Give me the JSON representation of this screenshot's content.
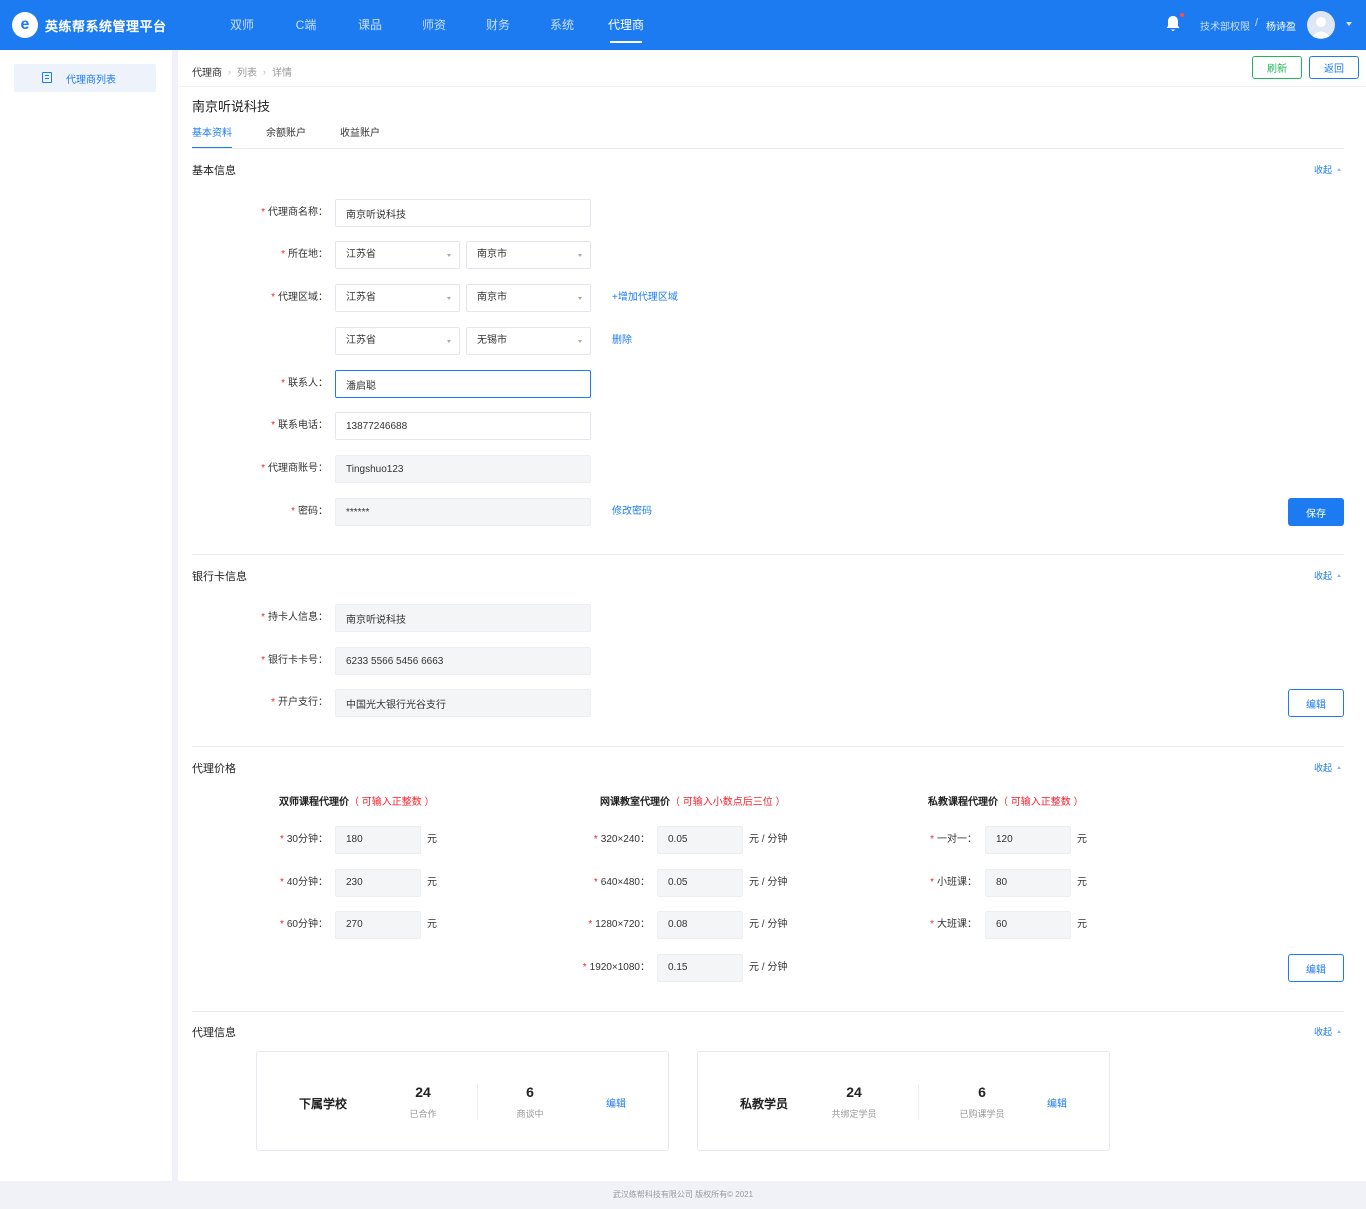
{
  "header": {
    "logo_mark": "e",
    "app_title": "英练帮系统管理平台",
    "nav": [
      "双师",
      "C端",
      "课品",
      "师资",
      "财务",
      "系统",
      "代理商"
    ],
    "active_nav": "代理商",
    "user_role": "技术部权限",
    "user_sep": "/",
    "user_name": "杨诗盈"
  },
  "sidebar": {
    "item_label": "代理商列表"
  },
  "main": {
    "breadcrumb": [
      "代理商",
      "列表",
      "详情"
    ],
    "refresh_label": "刷新",
    "back_label": "返回",
    "company_name": "南京听说科技",
    "tabs": [
      "基本资料",
      "余额账户",
      "收益账户"
    ],
    "collapse_label": "收起"
  },
  "basic": {
    "title": "基本信息",
    "name_label": "代理商名称：",
    "name_value": "南京听说科技",
    "location_label": "所在地：",
    "location_province": "江苏省",
    "location_city": "南京市",
    "region_label": "代理区域：",
    "region1_province": "江苏省",
    "region1_city": "南京市",
    "add_region_label": "+增加代理区域",
    "region2_province": "江苏省",
    "region2_city": "无锡市",
    "delete_label": "删除",
    "contact_label": "联系人：",
    "contact_value": "潘启聪",
    "phone_label": "联系电话：",
    "phone_value": "13877246688",
    "account_label": "代理商账号：",
    "account_value": "Tingshuo123",
    "password_label": "密码：",
    "password_value": "******",
    "change_password_label": "修改密码",
    "save_label": "保存"
  },
  "bank": {
    "title": "银行卡信息",
    "holder_label": "持卡人信息：",
    "holder_value": "南京听说科技",
    "card_label": "银行卡卡号：",
    "card_value": "6233 5566 5456 6663",
    "branch_label": "开户支行：",
    "branch_value": "中国光大银行光谷支行",
    "edit_label": "编辑"
  },
  "price": {
    "title": "代理价格",
    "edit_label": "编辑",
    "dual": {
      "title": "双师课程代理价",
      "hint": "（ 可输入正整数 ）",
      "unit": "元",
      "rows": [
        {
          "label": "30分钟：",
          "value": "180"
        },
        {
          "label": "40分钟：",
          "value": "230"
        },
        {
          "label": "60分钟：",
          "value": "270"
        }
      ]
    },
    "online": {
      "title": "网课教室代理价",
      "hint": "（ 可输入小数点后三位 ）",
      "unit": "元 / 分钟",
      "rows": [
        {
          "label": "320×240：",
          "value": "0.05"
        },
        {
          "label": "640×480：",
          "value": "0.05"
        },
        {
          "label": "1280×720：",
          "value": "0.08"
        },
        {
          "label": "1920×1080：",
          "value": "0.15"
        }
      ]
    },
    "private": {
      "title": "私教课程代理价",
      "hint": "（ 可输入正整数 ）",
      "unit": "元",
      "rows": [
        {
          "label": "一对一：",
          "value": "120"
        },
        {
          "label": "小班课：",
          "value": "80"
        },
        {
          "label": "大班课：",
          "value": "60"
        }
      ]
    }
  },
  "agent_info": {
    "title": "代理信息",
    "edit_label": "编辑",
    "schools": {
      "title": "下属学校",
      "stat1_num": "24",
      "stat1_label": "已合作",
      "stat2_num": "6",
      "stat2_label": "商谈中"
    },
    "students": {
      "title": "私教学员",
      "stat1_num": "24",
      "stat1_label": "共绑定学员",
      "stat2_num": "6",
      "stat2_label": "已购课学员"
    }
  },
  "footer": {
    "text": "武汉练帮科技有限公司 版权所有© 2021"
  }
}
